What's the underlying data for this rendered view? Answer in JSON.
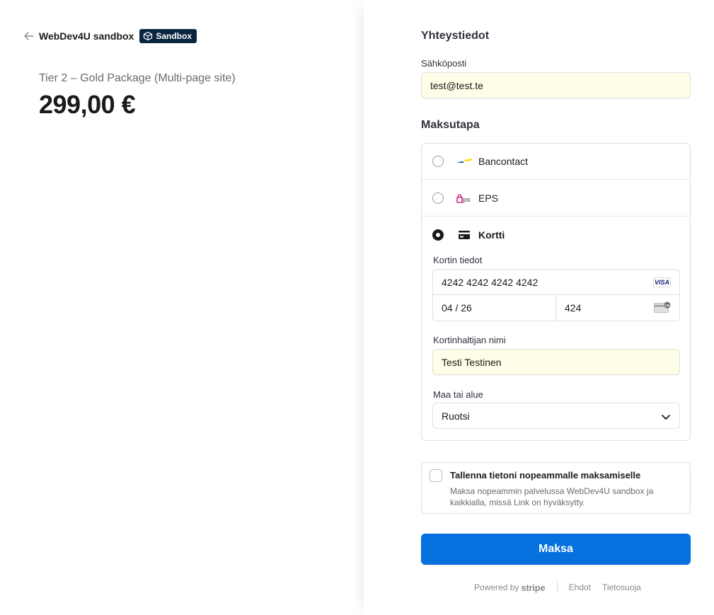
{
  "merchant": {
    "name": "WebDev4U sandbox",
    "badge": "Sandbox"
  },
  "product": {
    "name": "Tier 2 – Gold Package (Multi-page site)",
    "price": "299,00 €"
  },
  "contact": {
    "title": "Yhteystiedot",
    "email_label": "Sähköposti",
    "email_value": "test@test.te"
  },
  "payment": {
    "title": "Maksutapa",
    "methods": [
      {
        "label": "Bancontact",
        "icon": "bancontact-icon",
        "selected": false
      },
      {
        "label": "EPS",
        "icon": "eps-icon",
        "selected": false
      },
      {
        "label": "Kortti",
        "icon": "card-icon",
        "selected": true
      }
    ],
    "card_details_label": "Kortin tiedot",
    "card_number": "4242 4242 4242 4242",
    "card_brand": "VISA",
    "expiry": "04 / 26",
    "cvc": "424",
    "cvc_badge": "135",
    "cardholder_label": "Kortinhaltijan nimi",
    "cardholder_value": "Testi Testinen",
    "country_label": "Maa tai alue",
    "country_value": "Ruotsi"
  },
  "save": {
    "title": "Tallenna tietoni nopeammalle maksamiselle",
    "description": "Maksa nopeammin palvelussa WebDev4U sandbox ja kaikkialla, missä Link on hyväksytty.",
    "checked": false
  },
  "pay_button": "Maksa",
  "footer": {
    "powered_by": "Powered by",
    "stripe": "stripe",
    "terms": "Ehdot",
    "privacy": "Tietosuoja"
  },
  "colors": {
    "accent": "#0570de",
    "badge_bg": "#0a2540",
    "autofill_bg": "#fefde8"
  }
}
